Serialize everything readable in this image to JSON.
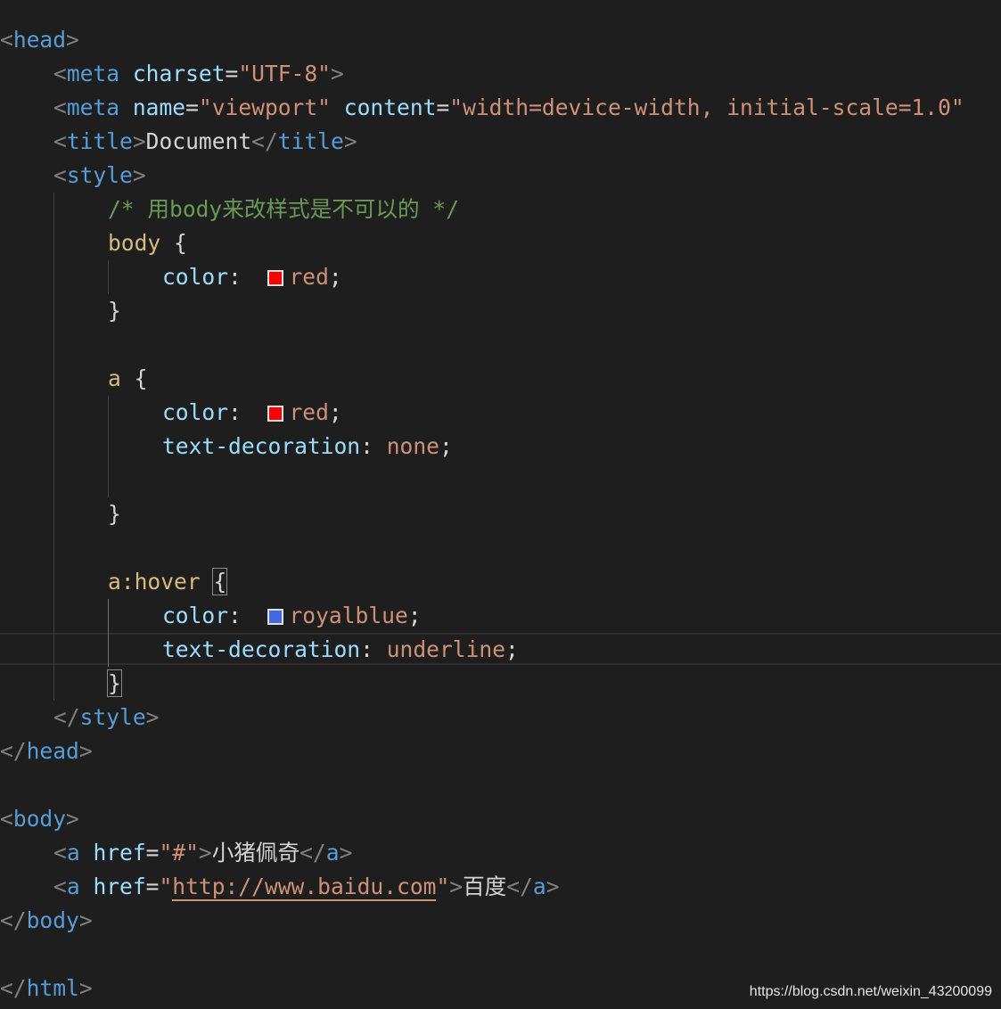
{
  "code": {
    "l1": [
      "<",
      "head",
      ">"
    ],
    "l2": [
      "<",
      "meta",
      "charset",
      "=",
      "\"UTF-8\"",
      ">"
    ],
    "l3": [
      "<",
      "meta",
      "name",
      "=",
      "\"viewport\"",
      "content",
      "=",
      "\"width=device-width, initial-scale=1.0\""
    ],
    "l4": [
      "<",
      "title",
      ">",
      "Document",
      "</",
      "title",
      ">"
    ],
    "l5": [
      "<",
      "style",
      ">"
    ],
    "l6": "/* 用body来改样式是不可以的 */",
    "l7": [
      "body",
      "{"
    ],
    "l8": [
      "color",
      ":",
      "red",
      ";"
    ],
    "l9": "}",
    "l11": [
      "a",
      "{"
    ],
    "l12": [
      "color",
      ":",
      "red",
      ";"
    ],
    "l13": [
      "text-decoration",
      ":",
      "none",
      ";"
    ],
    "l15": "}",
    "l17": [
      "a:hover",
      "{"
    ],
    "l18": [
      "color",
      ":",
      "royalblue",
      ";"
    ],
    "l19": [
      "text-decoration",
      ":",
      "underline",
      ";"
    ],
    "l20": "}",
    "l21": [
      "</",
      "style",
      ">"
    ],
    "l22": [
      "</",
      "head",
      ">"
    ],
    "l24": [
      "<",
      "body",
      ">"
    ],
    "l25": [
      "<",
      "a",
      "href",
      "=",
      "\"",
      "#",
      "\"",
      ">",
      "小猪佩奇",
      "</",
      "a",
      ">"
    ],
    "l26": [
      "<",
      "a",
      "href",
      "=",
      "\"",
      "http://www.baidu.com",
      "\"",
      ">",
      "百度",
      "</",
      "a",
      ">"
    ],
    "l27": [
      "</",
      "body",
      ">"
    ],
    "l29": [
      "</",
      "html",
      ">"
    ]
  },
  "colors": {
    "red": "#ff0000",
    "royalblue": "#4169e1"
  },
  "watermark": "https://blog.csdn.net/weixin_43200099"
}
